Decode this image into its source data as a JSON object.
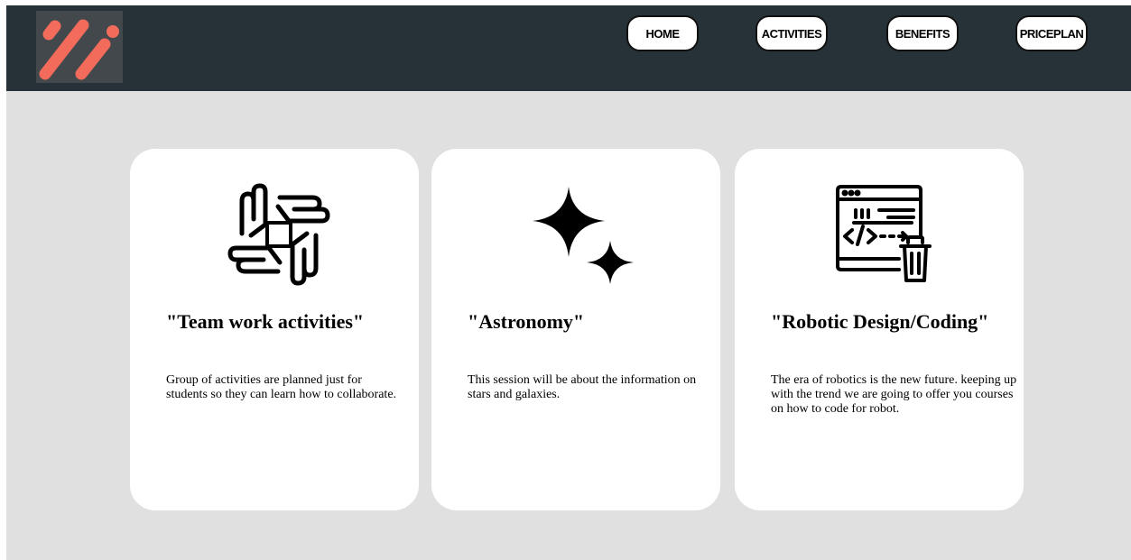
{
  "colors": {
    "header_bg": "#263238",
    "page_bg": "#e0e0e0",
    "logo_accent": "#f26b5b",
    "card_bg": "#ffffff"
  },
  "header": {
    "logo_icon": "three-slash-logo",
    "nav": [
      {
        "label": "HOME"
      },
      {
        "label": "ACTIVITIES"
      },
      {
        "label": "BENEFITS"
      },
      {
        "label": "PRICEPLAN"
      }
    ]
  },
  "cards": [
    {
      "icon": "teamwork-hands-icon",
      "title": "\"Team work activities\"",
      "description": "Group of activities are planned just for students so they can learn how to collaborate."
    },
    {
      "icon": "sparkle-stars-icon",
      "title": "\"Astronomy\"",
      "description": "This session will be about the information on stars and galaxies."
    },
    {
      "icon": "code-window-icon",
      "title": "\"Robotic Design/Coding\"",
      "description": "The era of robotics is the new future. keeping up with the trend we are going to offer you courses on how to code for robot."
    }
  ]
}
